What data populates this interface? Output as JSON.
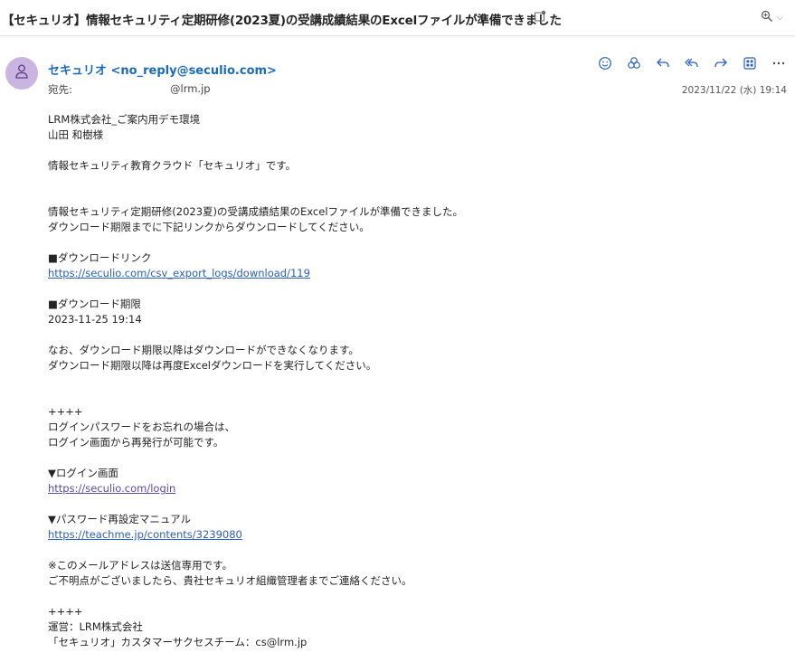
{
  "subject": "【セキュリオ】情報セキュリティ定期研修(2023夏)の受講成績結果のExcelファイルが準備できました",
  "header": {
    "sender_display": "セキュリオ <no_reply@seculio.com>",
    "to_label": "宛先:",
    "to_value": "@lrm.jp",
    "date": "2023/11/22 (水) 19:14"
  },
  "actions": [
    "emoji-icon",
    "apps-icon",
    "reply-icon",
    "reply-all-icon",
    "forward-icon",
    "grid-icon",
    "more-icon"
  ],
  "body": {
    "greeting1": "LRM株式会社_ご案内用デモ環境",
    "greeting2": "山田 和樹様",
    "intro": "情報セキュリティ教育クラウド「セキュリオ」です。",
    "msg1": "情報セキュリティ定期研修(2023夏)の受講成績結果のExcelファイルが準備できました。",
    "msg2": "ダウンロード期限までに下記リンクからダウンロードしてください。",
    "dl_link_heading": "■ダウンロードリンク",
    "dl_link": "https://seculio.com/csv_export_logs/download/119",
    "deadline_heading": "■ダウンロード期限",
    "deadline": "2023-11-25 19:14",
    "note1": "なお、ダウンロード期限以降はダウンロードができなくなります。",
    "note2": "ダウンロード期限以降は再度Excelダウンロードを実行してください。",
    "sep1": "++++",
    "pw1": "ログインパスワードをお忘れの場合は、",
    "pw2": "ログイン画面から再発行が可能です。",
    "login_heading": "▼ログイン画面",
    "login_link": "https://seculio.com/login",
    "manual_heading": "▼パスワード再設定マニュアル",
    "manual_link": "https://teachme.jp/contents/3239080",
    "send_only1": "※このメールアドレスは送信専用です。",
    "send_only2": "ご不明点がございましたら、貴社セキュリオ組織管理者までご連絡ください。",
    "sep2": "++++",
    "operator": "運営：LRM株式会社",
    "team": "「セキュリオ」カスタマーサクセスチーム：cs@lrm.jp"
  }
}
